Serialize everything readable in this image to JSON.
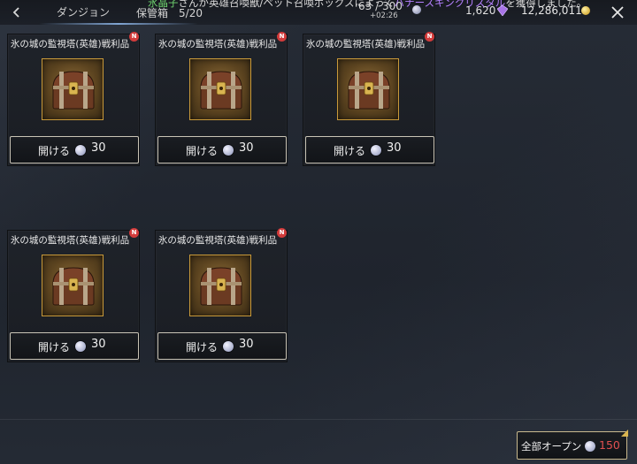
{
  "header": {
    "back_icon": "chevron-left-icon",
    "nav_title": "ダンジョン",
    "ticker": {
      "name": "氷晶子",
      "text1": "さんが英雄召喚獣/ペット召喚ボックスによって",
      "item": "バナースキンクリスタル",
      "text2": "を獲得しました。"
    },
    "storage_label": "保管箱",
    "storage_count": "5/20",
    "stamina": "63 / 300",
    "stamina_timer": "+02:26",
    "crystals": "1,620",
    "gold": "12,286,011",
    "close_icon": "close-icon"
  },
  "cards": [
    {
      "title": "氷の城の監視塔(英雄)戦利品",
      "badge": "N",
      "open_label": "開ける",
      "cost": "30"
    },
    {
      "title": "氷の城の監視塔(英雄)戦利品",
      "badge": "N",
      "open_label": "開ける",
      "cost": "30"
    },
    {
      "title": "氷の城の監視塔(英雄)戦利品",
      "badge": "N",
      "open_label": "開ける",
      "cost": "30"
    },
    {
      "title": "氷の城の監視塔(英雄)戦利品",
      "badge": "N",
      "open_label": "開ける",
      "cost": "30"
    },
    {
      "title": "氷の城の監視塔(英雄)戦利品",
      "badge": "N",
      "open_label": "開ける",
      "cost": "30"
    }
  ],
  "footer": {
    "open_all_label": "全部オープン",
    "open_all_cost": "150"
  },
  "colors": {
    "background": "#20252e",
    "button_border": "#c9c4b6",
    "frame_gold": "#c99a3a",
    "badge_red": "#d23b3b",
    "cost_red": "#e05050",
    "ticker_green": "#6fd46f",
    "ticker_purple": "#b580ff"
  }
}
